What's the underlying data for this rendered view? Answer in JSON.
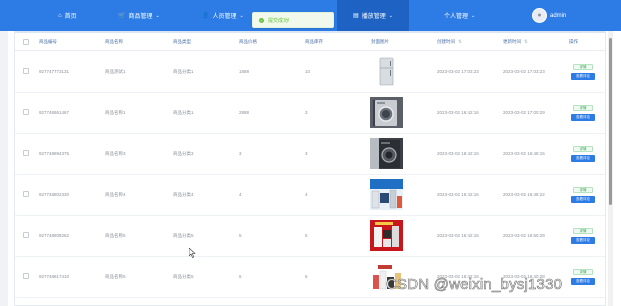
{
  "colors": {
    "nav": "#2d7be5",
    "nav_active": "#1e63c4",
    "success": "#67c23a"
  },
  "nav": {
    "items": [
      {
        "icon": "home-icon",
        "label": "首页"
      },
      {
        "icon": "cart-icon",
        "label": "商品管理"
      },
      {
        "icon": "user-icon",
        "label": "人员管理"
      },
      {
        "icon": "list-icon",
        "label": "播放管理"
      },
      {
        "icon": "person-icon",
        "label": "个人管理"
      }
    ],
    "user": "admin"
  },
  "toast": {
    "message": "提交成功!"
  },
  "table": {
    "headers": [
      "商品编号",
      "商品名称",
      "商品类型",
      "商品价格",
      "商品库存",
      "封面图片",
      "创建时间",
      "更新时间",
      "操作"
    ],
    "rows": [
      {
        "id": "927747773131",
        "name": "商品测试1",
        "type": "商品分类1",
        "price": "1888",
        "stock": "10",
        "created": "2023-03-02 17:03:23",
        "updated": "2023-03-02 17:03:23",
        "image": "fridge"
      },
      {
        "id": "927748861467",
        "name": "商品名称1",
        "type": "商品分类1",
        "price": "2888",
        "stock": "3",
        "created": "2023-03-02 16:42:16",
        "updated": "2023-03-02 17:00:29",
        "image": "washer"
      },
      {
        "id": "927748894375",
        "name": "商品名称3",
        "type": "商品分类3",
        "price": "3",
        "stock": "3",
        "created": "2023-03-02 16:42:16",
        "updated": "2023-03-02 16:48:15",
        "image": "washer-dark"
      },
      {
        "id": "927748802330",
        "name": "商品名称4",
        "type": "商品分类4",
        "price": "4",
        "stock": "4",
        "created": "2023-03-02 16:42:16",
        "updated": "2023-03-02 16:48:22",
        "image": "appliances"
      },
      {
        "id": "927748808262",
        "name": "商品名称5",
        "type": "商品分类5",
        "price": "5",
        "stock": "5",
        "created": "2023-03-02 16:42:16",
        "updated": "2023-03-02 16:50:29",
        "image": "red-appliances"
      },
      {
        "id": "927748817410",
        "name": "商品名称5",
        "type": "商品分类5",
        "price": "6",
        "stock": "6",
        "created": "2023-03-02 16:42:16",
        "updated": "2023-03-02 16:40:28",
        "image": "kitchen-set"
      }
    ],
    "actions": {
      "tag": "详情",
      "view": "查看评论"
    }
  },
  "watermark": "CSDN @weixin_bysj1330"
}
